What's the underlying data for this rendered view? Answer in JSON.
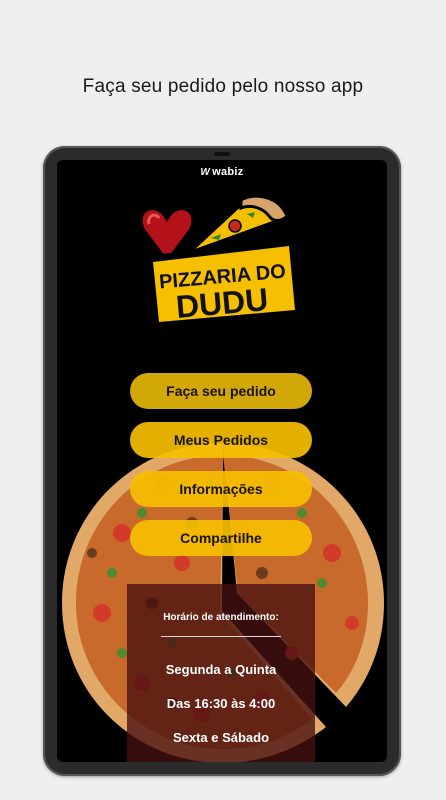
{
  "caption": "Faça seu pedido pelo nosso app",
  "brand": {
    "name": "wabiz",
    "mark": "W"
  },
  "logo": {
    "line1": "PIZZARIA DO",
    "line2": "DUDU"
  },
  "menu": {
    "order": "Faça seu pedido",
    "my_orders": "Meus Pedidos",
    "info": "Informações",
    "share": "Compartilhe"
  },
  "hours": {
    "title": "Horário de atendimento:",
    "line1": "Segunda a Quinta",
    "line2": "Das 16:30 às 4:00",
    "line3": "Sexta e Sábado"
  },
  "colors": {
    "accent": "#f6bf00",
    "accent_dark": "#d2a708",
    "heart": "#b3121a",
    "background": "#000000"
  }
}
